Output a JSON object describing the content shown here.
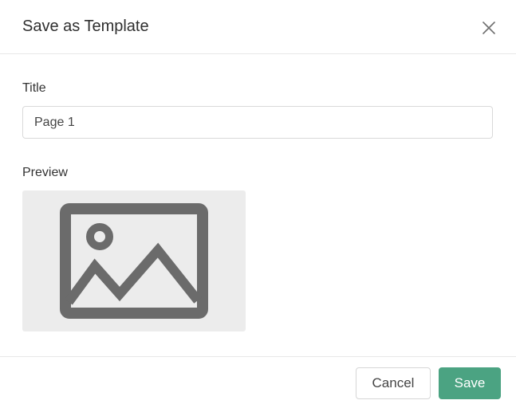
{
  "dialog": {
    "title": "Save as Template",
    "close_icon": "close-icon"
  },
  "form": {
    "title_label": "Title",
    "title_value": "Page 1",
    "preview_label": "Preview",
    "preview_icon": "image-placeholder-icon"
  },
  "footer": {
    "cancel_label": "Cancel",
    "save_label": "Save"
  },
  "colors": {
    "accent": "#4ba382",
    "preview_bg": "#ececec",
    "icon_gray": "#6b6b6b"
  }
}
